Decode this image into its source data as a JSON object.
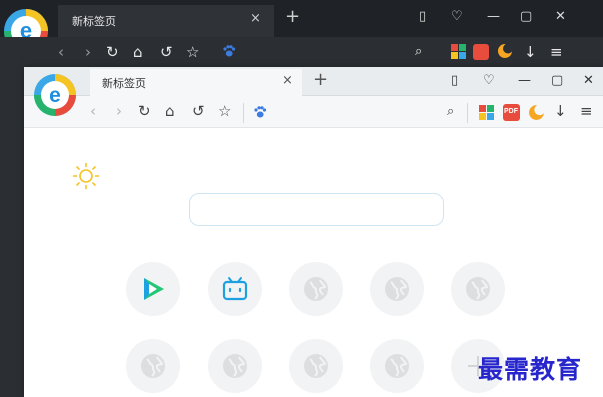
{
  "back_window": {
    "tab_title": "新标签页",
    "tab_close": "×",
    "new_tab": "+",
    "controls": {
      "mode": "▯",
      "skin": "♡",
      "minimize": "—",
      "maximize": "▢",
      "close": "✕"
    }
  },
  "front_window": {
    "tab_title": "新标签页",
    "tab_close": "×",
    "new_tab": "+",
    "controls": {
      "mode": "▯",
      "skin": "♡",
      "minimize": "—",
      "maximize": "▢",
      "close": "✕"
    },
    "toolbar": {
      "back": "‹",
      "forward": "›",
      "refresh": "↻",
      "home": "⌂",
      "undo": "↺",
      "favorite": "☆",
      "search": "⌕",
      "download": "↓",
      "menu": "≡",
      "pdf_label": "PDF"
    },
    "search_box": {
      "value": ""
    },
    "shortcut_tiles": [
      {
        "icon": "video-play-icon"
      },
      {
        "icon": "bilibili-tv-icon"
      },
      {
        "icon": "globe-icon"
      },
      {
        "icon": "globe-icon"
      },
      {
        "icon": "globe-icon"
      },
      {
        "icon": "globe-icon"
      },
      {
        "icon": "globe-icon"
      },
      {
        "icon": "globe-icon"
      },
      {
        "icon": "globe-icon"
      },
      {
        "icon": "add-icon"
      }
    ]
  },
  "watermark": "最需教育",
  "colors": {
    "accent_blue": "#1ea1e0",
    "play_green": "#23c777",
    "sun_yellow": "#f5c423",
    "pdf_red": "#e84c3d",
    "moon_orange": "#f6a623",
    "watermark": "#2626cc"
  }
}
